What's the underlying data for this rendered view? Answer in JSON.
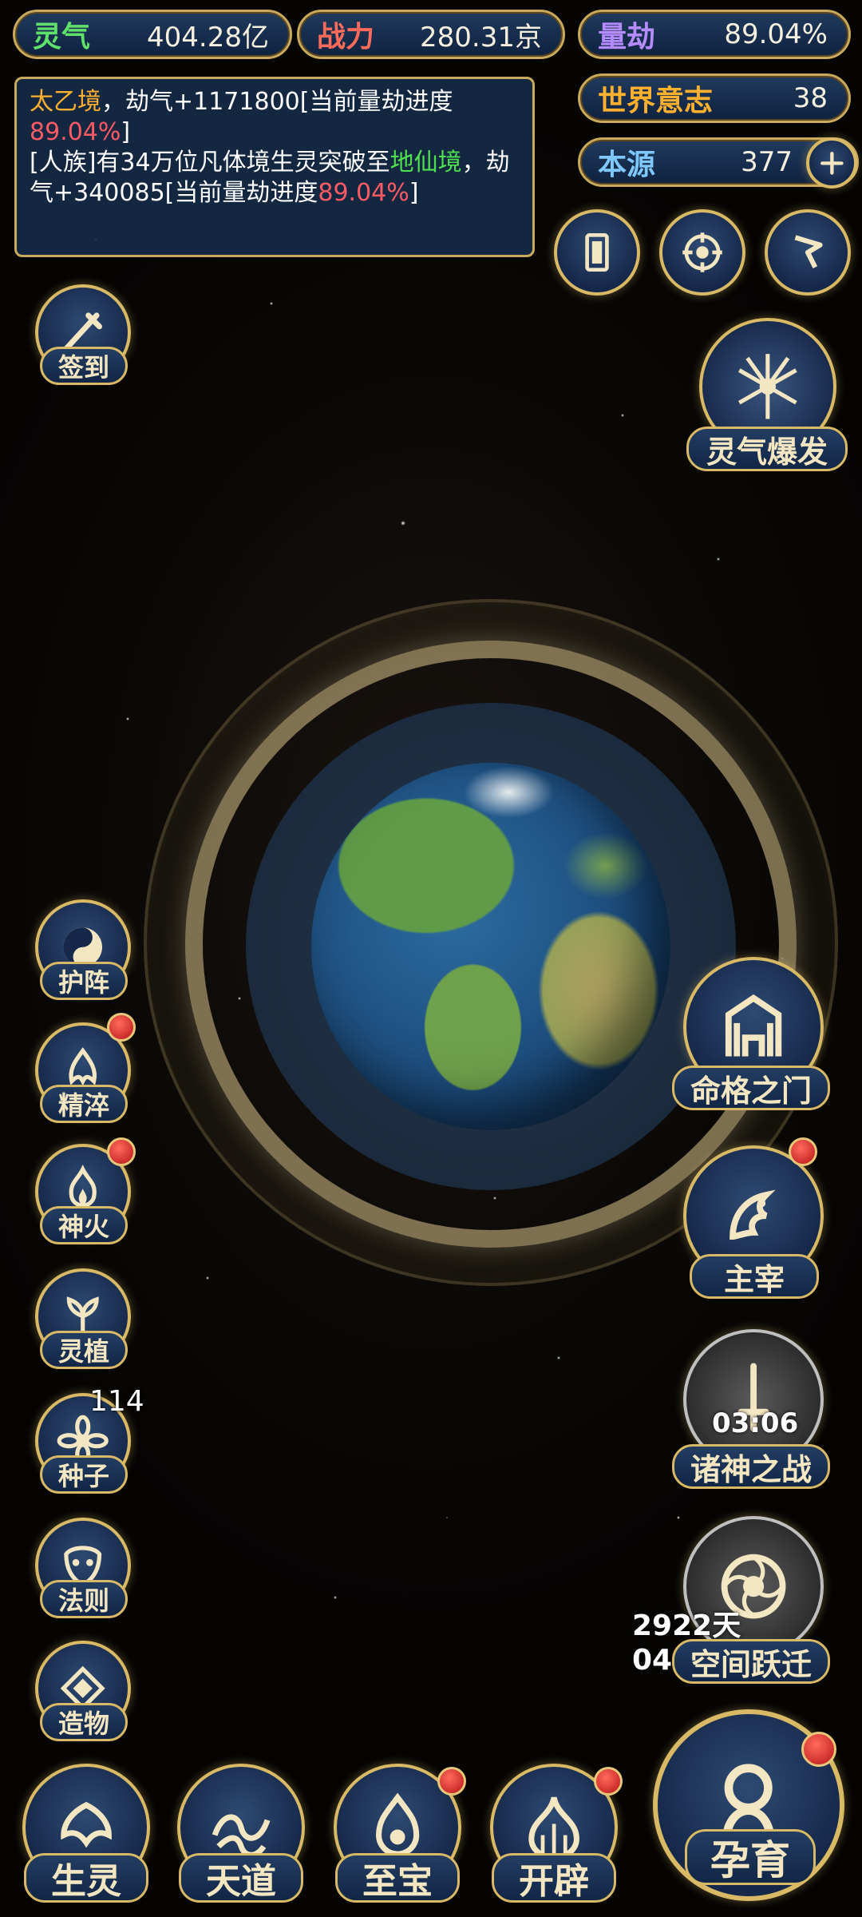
{
  "stats": {
    "lingqi": {
      "label": "灵气",
      "value": "404.28亿",
      "label_color": "#5fe06a"
    },
    "zhanli": {
      "label": "战力",
      "value": "280.31京",
      "label_color": "#ff6a5a"
    },
    "liangjie": {
      "label": "量劫",
      "value": "89.04%",
      "label_color": "#b58cff"
    },
    "shijie": {
      "label": "世界意志",
      "value": "38",
      "label_color": "#ffb02e"
    },
    "benyuan": {
      "label": "本源",
      "value": "377",
      "label_color": "#7fc8ff"
    }
  },
  "log": {
    "line1_a": "太乙境",
    "line1_b": "，劫气+1171800[当前量劫进度",
    "line1_c": "89.04%",
    "line1_d": "]",
    "line2_a": "[人族]有34万位凡体境生灵突破至",
    "line2_b": "地仙境",
    "line2_c": "，劫气+340085[当前量劫进度",
    "line2_d": "89.04%",
    "line2_e": "]"
  },
  "left_buttons": {
    "qiandao": "签到",
    "huzhen": "护阵",
    "jingcui": "精淬",
    "shenhuo": "神火",
    "lingzhi": "灵植",
    "zhongzi": "种子",
    "zhongzi_count": "114",
    "faze": "法则",
    "zaowu": "造物"
  },
  "right_buttons": {
    "lingqi_baofa": "灵气爆发",
    "mingge": "命格之门",
    "zhuzai": "主宰",
    "zhushen": "诸神之战",
    "zhushen_timer": "03:06",
    "kongjian": "空间跃迁",
    "kongjian_timer": "2922天04:00:24"
  },
  "bottom_nav": {
    "shengling": "生灵",
    "tiandao": "天道",
    "zhibao": "至宝",
    "kaipi": "开辟",
    "yunyu": "孕育"
  },
  "icons": {
    "top_right": [
      "card-icon",
      "swirl-icon",
      "flag-icon"
    ],
    "plus": "plus-icon"
  },
  "colors": {
    "gold": "#d8b965",
    "navy": "#16284a",
    "badge_red": "#c91d22"
  }
}
